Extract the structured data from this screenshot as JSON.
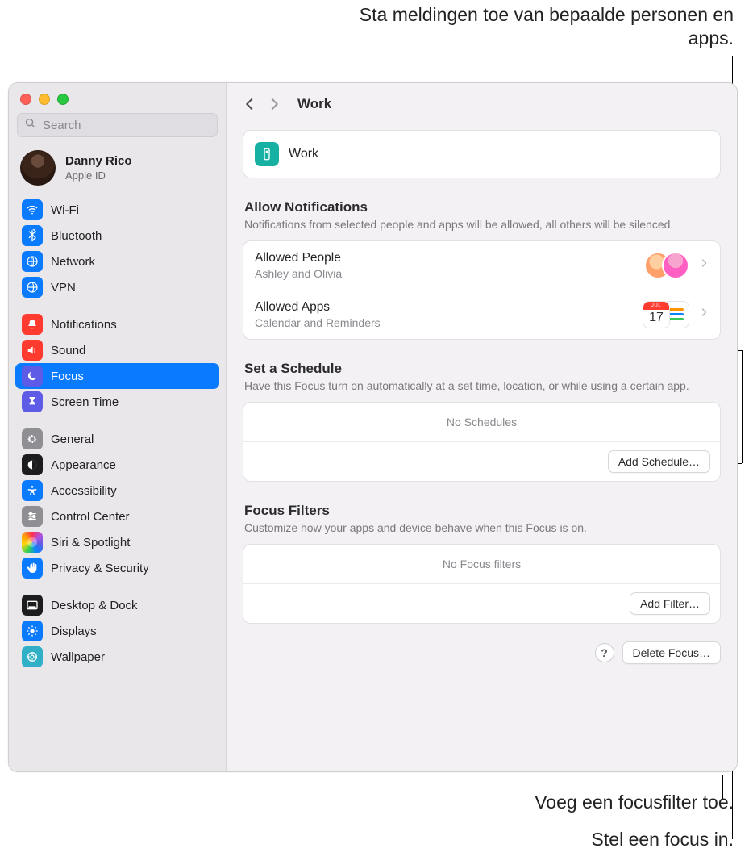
{
  "annotations": {
    "top": "Sta meldingen toe van bepaalde personen en apps.",
    "bottom1": "Voeg een focusfilter toe.",
    "bottom2": "Stel een focus in."
  },
  "search": {
    "placeholder": "Search"
  },
  "profile": {
    "name": "Danny Rico",
    "sub": "Apple ID"
  },
  "sidebar": {
    "groups": [
      [
        {
          "label": "Wi-Fi",
          "icon": "wifi",
          "color": "blue"
        },
        {
          "label": "Bluetooth",
          "icon": "bluetooth",
          "color": "blue"
        },
        {
          "label": "Network",
          "icon": "network",
          "color": "blue"
        },
        {
          "label": "VPN",
          "icon": "vpn",
          "color": "blue"
        }
      ],
      [
        {
          "label": "Notifications",
          "icon": "bell",
          "color": "red"
        },
        {
          "label": "Sound",
          "icon": "speaker",
          "color": "red"
        },
        {
          "label": "Focus",
          "icon": "moon",
          "color": "ind",
          "active": true
        },
        {
          "label": "Screen Time",
          "icon": "hourglass",
          "color": "ind"
        }
      ],
      [
        {
          "label": "General",
          "icon": "gear",
          "color": "gray"
        },
        {
          "label": "Appearance",
          "icon": "appearance",
          "color": "black"
        },
        {
          "label": "Accessibility",
          "icon": "accessibility",
          "color": "blue"
        },
        {
          "label": "Control Center",
          "icon": "sliders",
          "color": "gray"
        },
        {
          "label": "Siri & Spotlight",
          "icon": "siri",
          "color": "siri"
        },
        {
          "label": "Privacy & Security",
          "icon": "hand",
          "color": "blue"
        }
      ],
      [
        {
          "label": "Desktop & Dock",
          "icon": "dock",
          "color": "black"
        },
        {
          "label": "Displays",
          "icon": "display",
          "color": "blue"
        },
        {
          "label": "Wallpaper",
          "icon": "wallpaper",
          "color": "teal"
        }
      ]
    ]
  },
  "header": {
    "title": "Work"
  },
  "hero": {
    "title": "Work"
  },
  "allow": {
    "heading": "Allow Notifications",
    "desc": "Notifications from selected people and apps will be allowed, all others will be silenced.",
    "people_title": "Allowed People",
    "people_sub": "Ashley and Olivia",
    "apps_title": "Allowed Apps",
    "apps_sub": "Calendar and Reminders",
    "cal_day": "17",
    "cal_top": "JUL"
  },
  "schedule": {
    "heading": "Set a Schedule",
    "desc": "Have this Focus turn on automatically at a set time, location, or while using a certain app.",
    "empty": "No Schedules",
    "button": "Add Schedule…"
  },
  "filters": {
    "heading": "Focus Filters",
    "desc": "Customize how your apps and device behave when this Focus is on.",
    "empty": "No Focus filters",
    "button": "Add Filter…"
  },
  "footer": {
    "help": "?",
    "delete": "Delete Focus…"
  }
}
